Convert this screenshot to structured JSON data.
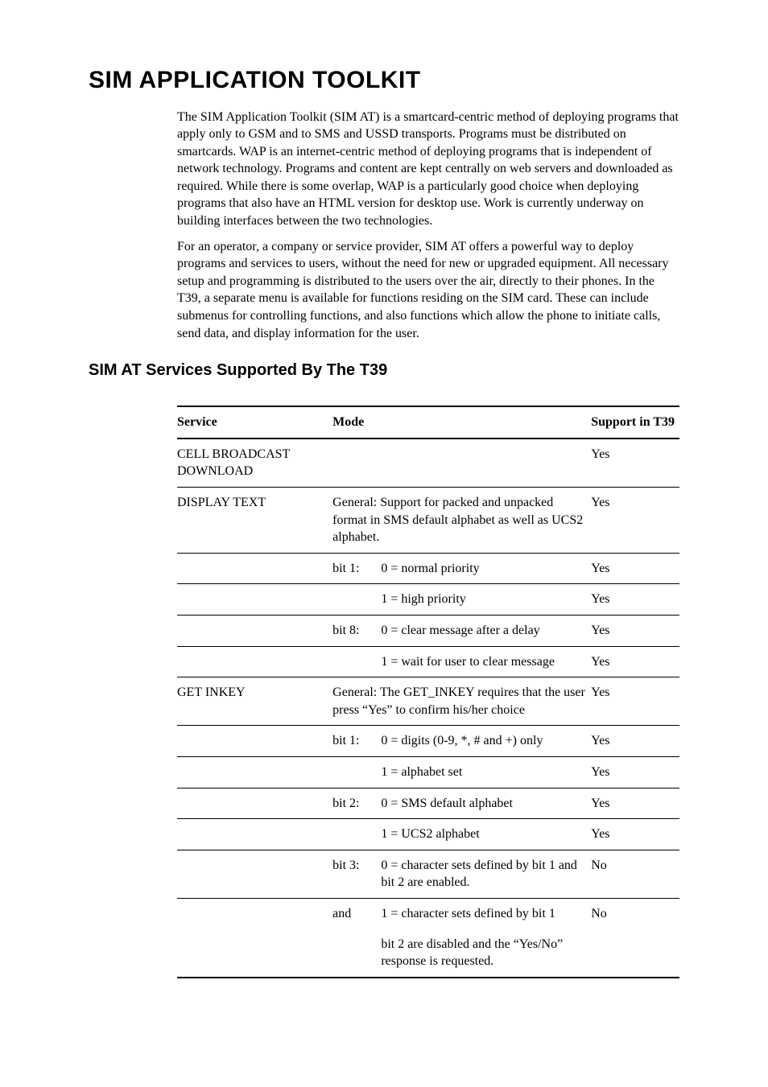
{
  "title": "SIM APPLICATION TOOLKIT",
  "para1": "The SIM Application Toolkit (SIM AT) is a smartcard-centric method of deploying programs that apply only to GSM and to SMS and USSD transports. Programs must be distributed on smartcards. WAP is an internet-centric method of deploying programs that is independent of network technology. Programs and content are kept centrally on web servers and downloaded as required. While there is some overlap, WAP is a particularly good choice when deploying programs that also have an HTML version for desktop use. Work is currently underway on building interfaces between the two technologies.",
  "para2": "For an operator, a company or service provider, SIM AT offers a powerful way to deploy programs and services to users, without the need for new or upgraded equipment. All necessary setup and programming is distributed to the users over the air, directly to their phones. In the T39, a separate menu is available for functions residing on the SIM card. These can include submenus for controlling functions, and also functions which allow the phone to initiate calls, send data, and display information for the user.",
  "section_title": "SIM AT Services Supported By The T39",
  "headers": {
    "service": "Service",
    "mode": "Mode",
    "support": "Support in T39"
  },
  "rows": {
    "cell_broadcast": {
      "service": "CELL BROADCAST DOWNLOAD",
      "support": "Yes"
    },
    "display_text": {
      "service": "DISPLAY TEXT",
      "general": "General: Support for packed and unpacked format in SMS default alphabet as well as UCS2 alphabet.",
      "r1": {
        "bit": "bit 1:",
        "desc": "0 = normal priority",
        "sup": "Yes"
      },
      "r2": {
        "bit": "",
        "desc": "1 = high priority",
        "sup": "Yes"
      },
      "r3": {
        "bit": "bit 8:",
        "desc": "0 = clear message after a delay",
        "sup": "Yes"
      },
      "r4": {
        "bit": "",
        "desc": "1 = wait for user to clear message",
        "sup": "Yes"
      },
      "gsup": "Yes"
    },
    "get_inkey": {
      "service": "GET INKEY",
      "general": "General: The GET_INKEY requires that the user press “Yes” to confirm his/her choice",
      "gsup": "Yes",
      "r1": {
        "bit": "bit 1:",
        "desc": "0 = digits (0-9, *, # and +) only",
        "sup": "Yes"
      },
      "r2": {
        "bit": "",
        "desc": "1 = alphabet set",
        "sup": "Yes"
      },
      "r3": {
        "bit": "bit 2:",
        "desc": "0 = SMS default alphabet",
        "sup": "Yes"
      },
      "r4": {
        "bit": "",
        "desc": "1 = UCS2 alphabet",
        "sup": "Yes"
      },
      "r5": {
        "bit": "bit 3:",
        "desc": "0 = character sets defined by bit 1 and bit 2 are enabled.",
        "sup": "No"
      },
      "r6": {
        "bit": "and",
        "desc": "1 = character sets defined by bit 1",
        "sup": "No"
      },
      "r7": {
        "bit": "",
        "desc": "bit 2 are disabled and the “Yes/No” response is requested.",
        "sup": ""
      }
    }
  }
}
